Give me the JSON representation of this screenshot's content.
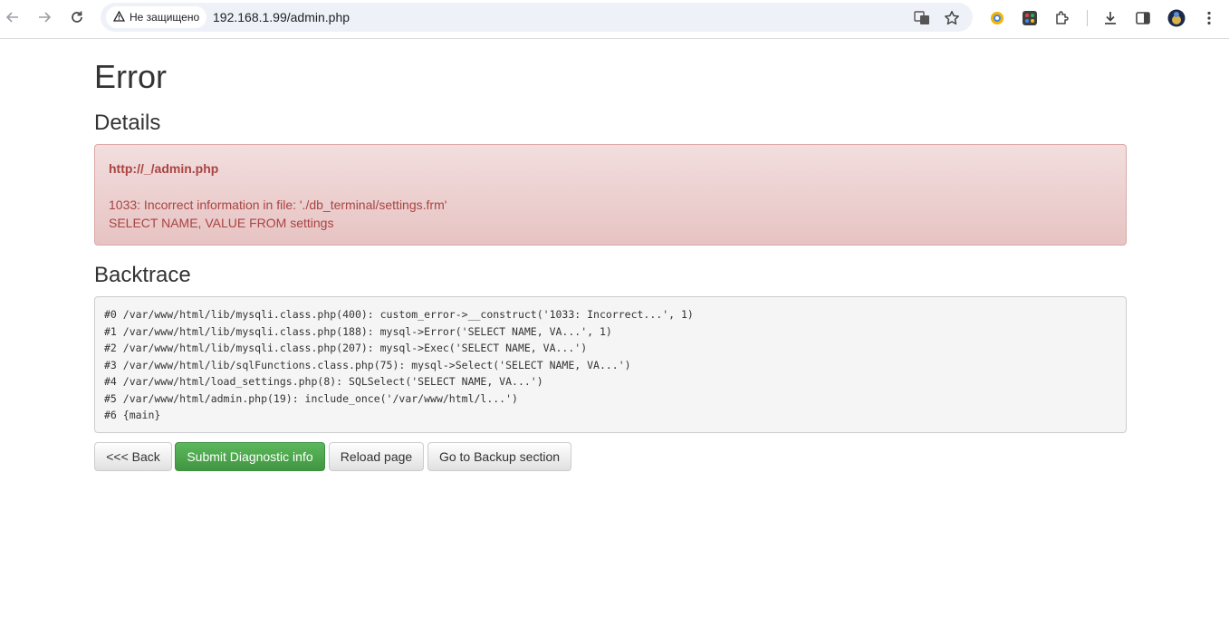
{
  "browser": {
    "security_label": "Не защищено",
    "url": "192.168.1.99/admin.php"
  },
  "page": {
    "title": "Error",
    "details_heading": "Details",
    "alert": {
      "url": "http://_/admin.php",
      "message": "1033: Incorrect information in file: './db_terminal/settings.frm'",
      "query": "SELECT NAME, VALUE FROM settings"
    },
    "backtrace_heading": "Backtrace",
    "backtrace": [
      "#0 /var/www/html/lib/mysqli.class.php(400): custom_error->__construct('1033: Incorrect...', 1)",
      "#1 /var/www/html/lib/mysqli.class.php(188): mysql->Error('SELECT NAME, VA...', 1)",
      "#2 /var/www/html/lib/mysqli.class.php(207): mysql->Exec('SELECT NAME, VA...')",
      "#3 /var/www/html/lib/sqlFunctions.class.php(75): mysql->Select('SELECT NAME, VA...')",
      "#4 /var/www/html/load_settings.php(8): SQLSelect('SELECT NAME, VA...')",
      "#5 /var/www/html/admin.php(19): include_once('/var/www/html/l...')",
      "#6 {main}"
    ],
    "buttons": {
      "back": "<<< Back",
      "submit": "Submit Diagnostic info",
      "reload": "Reload page",
      "backup": "Go to Backup section"
    }
  },
  "colors": {
    "alert_text": "#a94442",
    "alert_bg": "#f2dede",
    "success": "#5cb85c"
  }
}
